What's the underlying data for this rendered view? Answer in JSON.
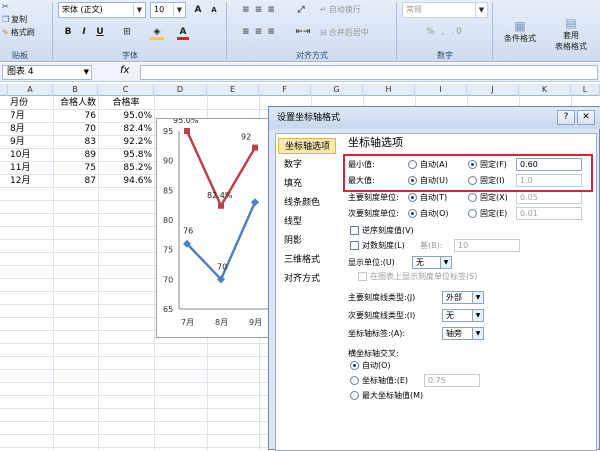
{
  "ribbon": {
    "clipboard": {
      "copy": "复制",
      "format_painter": "格式刷",
      "group": "贴板"
    },
    "font": {
      "name": "宋体 (正文)",
      "size": "10",
      "bold": "B",
      "italic": "I",
      "underline": "U",
      "grow": "A",
      "shrink": "A",
      "group": "字体"
    },
    "alignment": {
      "wrap": "自动换行",
      "merge": "合并后居中",
      "group": "对齐方式"
    },
    "number": {
      "format": "常规",
      "group": "数字"
    },
    "styles": {
      "conditional": "条件格式",
      "table1": "套用",
      "table2": "表格格式"
    }
  },
  "formula_bar": {
    "name_box": "图表 4",
    "fx": "fx",
    "value": ""
  },
  "columns": [
    "A",
    "B",
    "C",
    "D",
    "E",
    "F",
    "G",
    "H",
    "I",
    "J",
    "K",
    "L"
  ],
  "table": {
    "headers": [
      "月份",
      "合格人数",
      "合格率"
    ],
    "rows": [
      [
        "7月",
        "76",
        "95.0%"
      ],
      [
        "8月",
        "70",
        "82.4%"
      ],
      [
        "9月",
        "83",
        "92.2%"
      ],
      [
        "10月",
        "89",
        "95.8%"
      ],
      [
        "11月",
        "75",
        "85.2%"
      ],
      [
        "12月",
        "87",
        "94.6%"
      ]
    ]
  },
  "chart_data": {
    "type": "line",
    "categories": [
      "7月",
      "8月",
      "9月"
    ],
    "series": [
      {
        "values": [
          95.0,
          82.4,
          92.2
        ],
        "labels": [
          "95.0%",
          "82.4%",
          "92"
        ],
        "color": "#b8434b"
      },
      {
        "values": [
          76,
          70,
          83
        ],
        "labels": [
          "76",
          "70",
          ""
        ],
        "color": "#4f81bd"
      }
    ],
    "y_ticks": [
      "95",
      "90",
      "85",
      "80",
      "75",
      "70",
      "65"
    ],
    "ylim": [
      65,
      95
    ]
  },
  "dialog": {
    "title": "设置坐标轴格式",
    "nav": [
      "坐标轴选项",
      "数字",
      "填充",
      "线条颜色",
      "线型",
      "阴影",
      "三维格式",
      "对齐方式"
    ],
    "section": "坐标轴选项",
    "min_label": "最小值:",
    "max_label": "最大值:",
    "major_unit": "主要刻度单位:",
    "minor_unit": "次要刻度单位:",
    "auto": "自动",
    "fixed": "固定",
    "min_value": "0.60",
    "max_value": "1.0",
    "major_value": "0.05",
    "minor_value": "0.01",
    "reverse": "逆序刻度值",
    "log": "对数刻度",
    "base_label": "基",
    "base_value": "10",
    "display_unit": "显示单位:",
    "display_unit_value": "无",
    "show_unit_label": "在图表上显示刻度单位标签",
    "major_tick_type": "主要刻度线类型:",
    "major_tick_value": "外部",
    "minor_tick_type": "次要刻度线类型:",
    "minor_tick_value": "无",
    "axis_label": "坐标轴标签:",
    "axis_label_value": "轴旁",
    "cross_title": "横坐标轴交叉:",
    "cross_auto": "自动",
    "cross_value_label": "坐标轴值:",
    "cross_value": "0.75",
    "cross_max": "最大坐标轴值"
  }
}
